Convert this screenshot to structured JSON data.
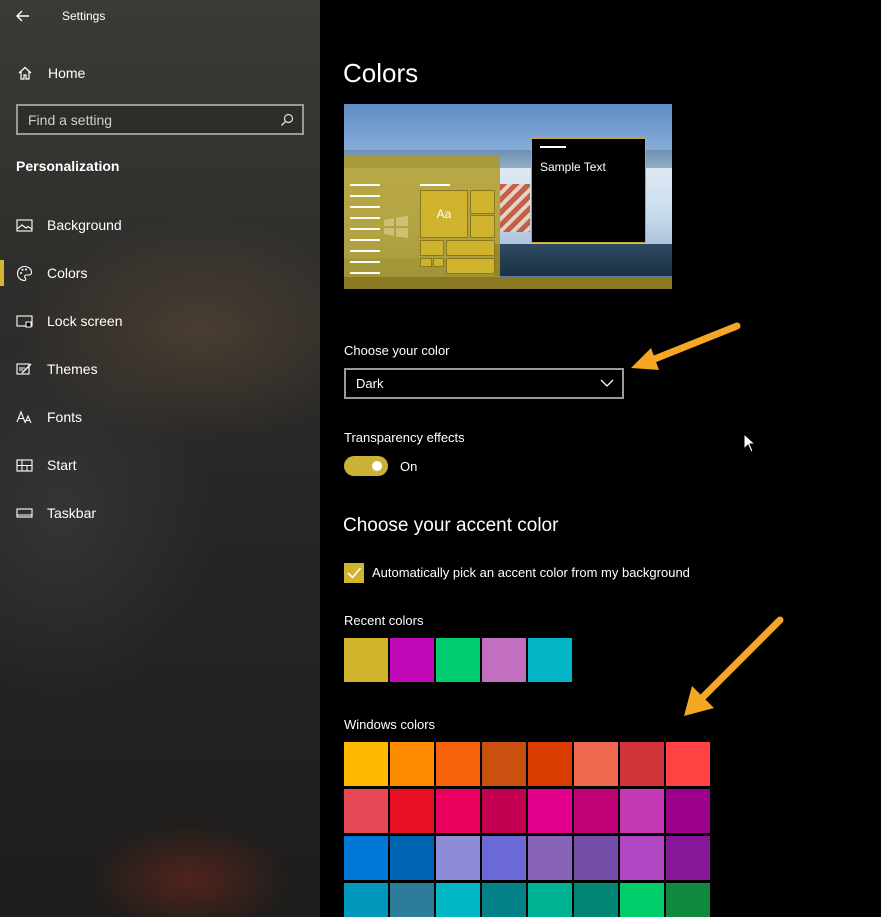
{
  "window": {
    "title": "Settings"
  },
  "sidebar": {
    "home_label": "Home",
    "search_placeholder": "Find a setting",
    "section": "Personalization",
    "items": [
      {
        "label": "Background",
        "icon": "picture-icon",
        "selected": false
      },
      {
        "label": "Colors",
        "icon": "palette-icon",
        "selected": true
      },
      {
        "label": "Lock screen",
        "icon": "lock-screen-icon",
        "selected": false
      },
      {
        "label": "Themes",
        "icon": "themes-icon",
        "selected": false
      },
      {
        "label": "Fonts",
        "icon": "fonts-icon",
        "selected": false
      },
      {
        "label": "Start",
        "icon": "start-icon",
        "selected": false
      },
      {
        "label": "Taskbar",
        "icon": "taskbar-icon",
        "selected": false
      }
    ]
  },
  "main": {
    "title": "Colors",
    "preview": {
      "tile_label": "Aa",
      "sample_text": "Sample Text"
    },
    "choose_color": {
      "label": "Choose your color",
      "value": "Dark"
    },
    "transparency": {
      "label": "Transparency effects",
      "state": "On"
    },
    "accent": {
      "title": "Choose your accent color",
      "auto_pick_label": "Automatically pick an accent color from my background",
      "auto_pick_checked": true
    },
    "recent_colors": {
      "label": "Recent colors",
      "colors": [
        "#d0b42c",
        "#c209b8",
        "#01cc6f",
        "#c36fbf",
        "#02b6c7"
      ]
    },
    "windows_colors": {
      "label": "Windows colors",
      "rows": [
        [
          "#ffb900",
          "#ff8c00",
          "#f7630c",
          "#ca5010",
          "#da3b01",
          "#ef6950",
          "#d13438",
          "#ff4343"
        ],
        [
          "#e74856",
          "#e81123",
          "#ea005e",
          "#c30052",
          "#e3008c",
          "#bf0077",
          "#c239b3",
          "#9a0089"
        ],
        [
          "#0078d7",
          "#0063b1",
          "#8e8cd8",
          "#6b69d6",
          "#8764b8",
          "#744da9",
          "#b146c2",
          "#881798"
        ],
        [
          "#0099bc",
          "#2d7d9a",
          "#00b7c3",
          "#038387",
          "#00b294",
          "#018574",
          "#00cc6a",
          "#10893e"
        ]
      ]
    }
  },
  "colors": {
    "accent": "#d4b62f",
    "annotation_arrow": "#f5a623"
  }
}
